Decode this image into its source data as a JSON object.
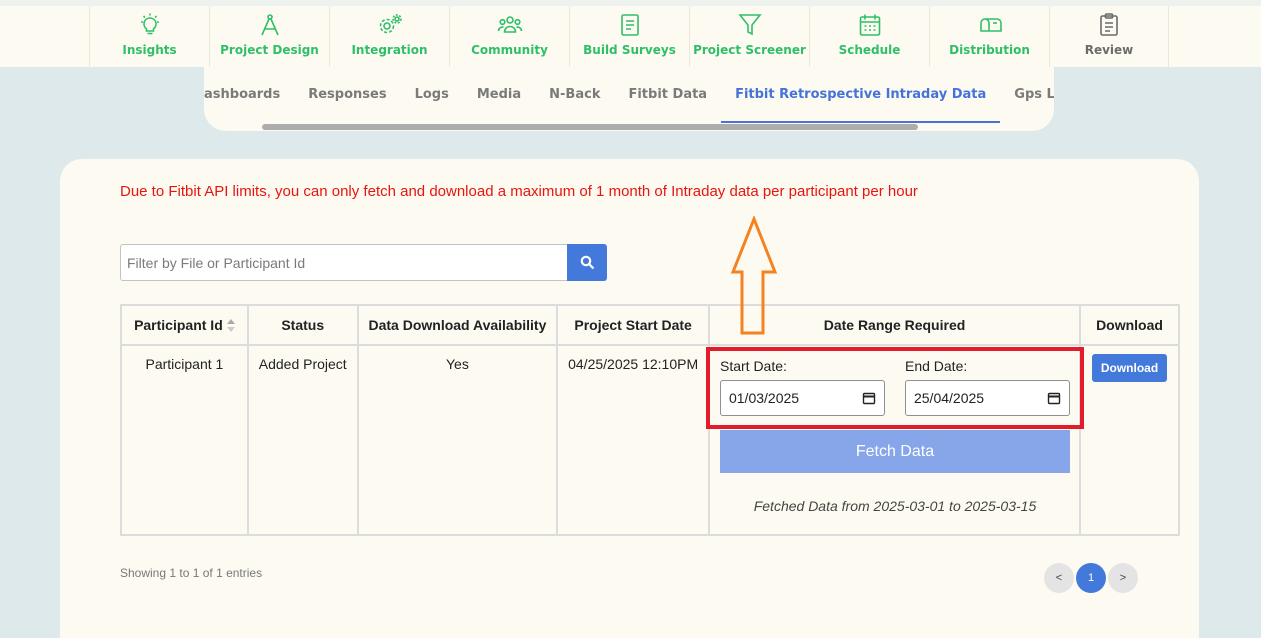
{
  "topnav": {
    "items": [
      {
        "label": "Insights",
        "icon": "lightbulb-icon"
      },
      {
        "label": "Project Design",
        "icon": "compass-icon"
      },
      {
        "label": "Integration",
        "icon": "gears-icon"
      },
      {
        "label": "Community",
        "icon": "people-icon"
      },
      {
        "label": "Build Surveys",
        "icon": "document-icon"
      },
      {
        "label": "Project Screener",
        "icon": "filter-icon"
      },
      {
        "label": "Schedule",
        "icon": "calendar-icon"
      },
      {
        "label": "Distribution",
        "icon": "mailbox-icon"
      },
      {
        "label": "Review",
        "icon": "clipboard-icon"
      }
    ],
    "active_color": "#2fbf69"
  },
  "subtabs": {
    "items": [
      "ashboards",
      "Responses",
      "Logs",
      "Media",
      "N-Back",
      "Fitbit Data",
      "Fitbit Retrospective Intraday Data",
      "Gps Locatio"
    ],
    "active": "Fitbit Retrospective Intraday Data",
    "active_color": "#4573d9"
  },
  "notice": "Due to Fitbit API limits, you can only fetch and download a maximum of 1 month of Intraday data per participant per hour",
  "search": {
    "placeholder": "Filter by File or Participant Id",
    "icon": "search-icon"
  },
  "table": {
    "headers": [
      "Participant Id",
      "Status",
      "Data Download Availability",
      "Project Start Date",
      "Date Range Required",
      "Download"
    ],
    "rows": [
      {
        "participant_id": "Participant 1",
        "status": "Added Project",
        "availability": "Yes",
        "start_date": "04/25/2025 12:10PM",
        "start_label": "Start Date:",
        "start_value": "01/03/2025",
        "end_label": "End Date:",
        "end_value": "25/04/2025",
        "fetch_label": "Fetch Data",
        "fetched_note": "Fetched Data from 2025-03-01 to 2025-03-15",
        "download_label": "Download"
      }
    ]
  },
  "footer": {
    "info": "Showing 1 to 1 of 1 entries",
    "pager": {
      "prev": "<",
      "current": "1",
      "next": ">"
    }
  },
  "accent": "#4279db",
  "highlight_color": "#e11d2b",
  "arrow_color": "#f58220"
}
